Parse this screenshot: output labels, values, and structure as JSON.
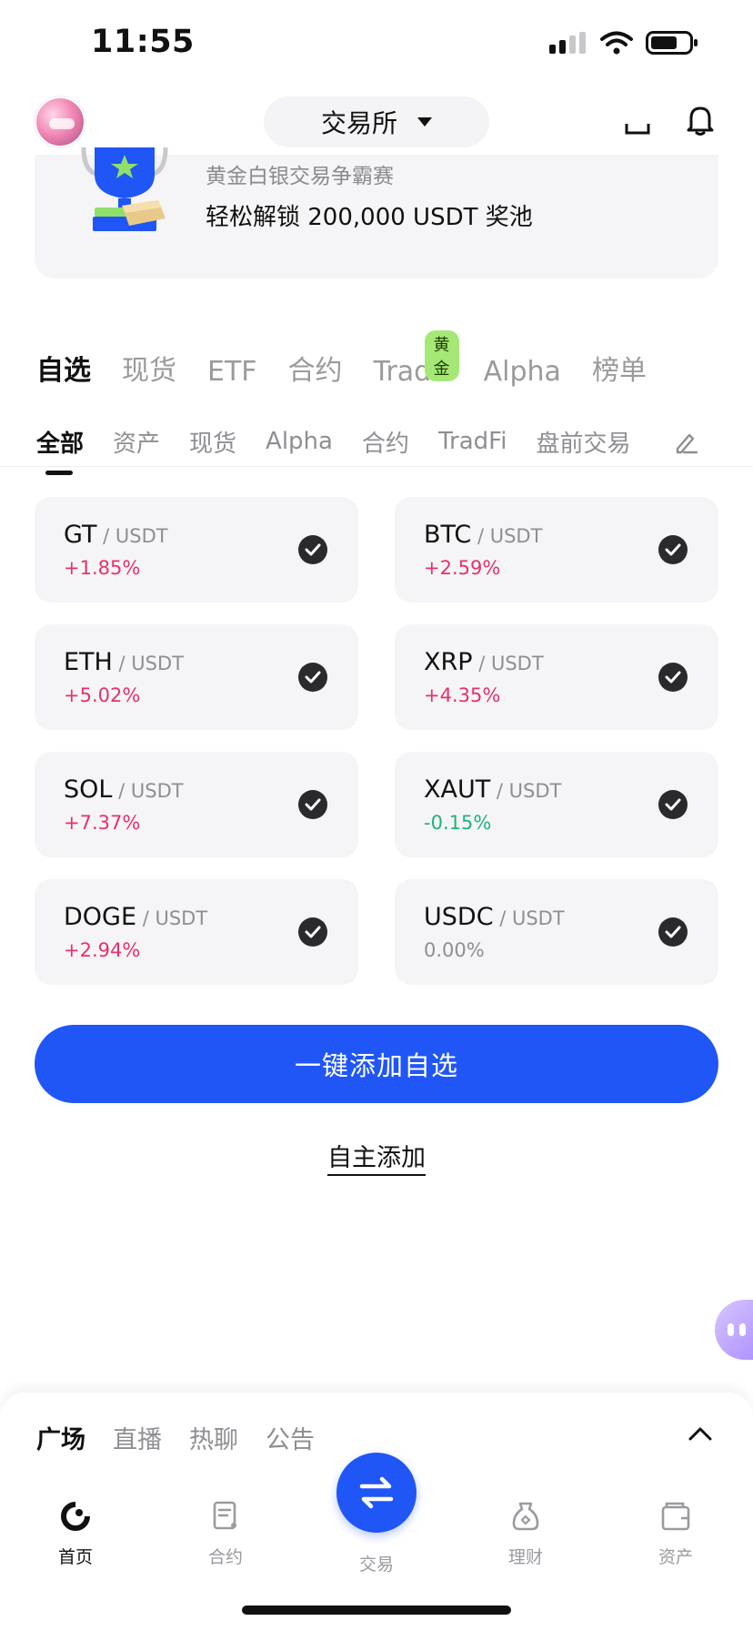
{
  "status_bar": {
    "time": "11:55"
  },
  "header": {
    "exchange_label": "交易所"
  },
  "banner": {
    "subtitle": "黄金白银交易争霸赛",
    "title": "轻松解锁 200,000 USDT 奖池"
  },
  "main_tabs": [
    {
      "label": "自选",
      "active": true
    },
    {
      "label": "现货"
    },
    {
      "label": "ETF"
    },
    {
      "label": "合约"
    },
    {
      "label": "TradFi",
      "badge": "黄金"
    },
    {
      "label": "Alpha"
    },
    {
      "label": "榜单"
    }
  ],
  "sub_tabs": [
    {
      "label": "全部",
      "active": true
    },
    {
      "label": "资产"
    },
    {
      "label": "现货"
    },
    {
      "label": "Alpha"
    },
    {
      "label": "合约"
    },
    {
      "label": "TradFi"
    },
    {
      "label": "盘前交易"
    }
  ],
  "coins": [
    {
      "symbol": "GT",
      "quote": " / USDT",
      "change": "+1.85%",
      "direction": "up"
    },
    {
      "symbol": "BTC",
      "quote": " / USDT",
      "change": "+2.59%",
      "direction": "up"
    },
    {
      "symbol": "ETH",
      "quote": " / USDT",
      "change": "+5.02%",
      "direction": "up"
    },
    {
      "symbol": "XRP",
      "quote": " / USDT",
      "change": "+4.35%",
      "direction": "up"
    },
    {
      "symbol": "SOL",
      "quote": " / USDT",
      "change": "+7.37%",
      "direction": "up"
    },
    {
      "symbol": "XAUT",
      "quote": " / USDT",
      "change": "-0.15%",
      "direction": "down"
    },
    {
      "symbol": "DOGE",
      "quote": " / USDT",
      "change": "+2.94%",
      "direction": "up"
    },
    {
      "symbol": "USDC",
      "quote": " / USDT",
      "change": "0.00%",
      "direction": "flat"
    }
  ],
  "actions": {
    "add_all_label": "一键添加自选",
    "manual_add_label": "自主添加"
  },
  "feed_tabs": [
    {
      "label": "广场",
      "active": true
    },
    {
      "label": "直播"
    },
    {
      "label": "热聊"
    },
    {
      "label": "公告"
    }
  ],
  "bottom_nav": {
    "home": "首页",
    "futures": "合约",
    "trade": "交易",
    "earn": "理财",
    "assets": "资产"
  },
  "colors": {
    "accent": "#1f56f5",
    "up": "#e8306a",
    "down": "#22b37a",
    "badge": "#a6e875"
  }
}
